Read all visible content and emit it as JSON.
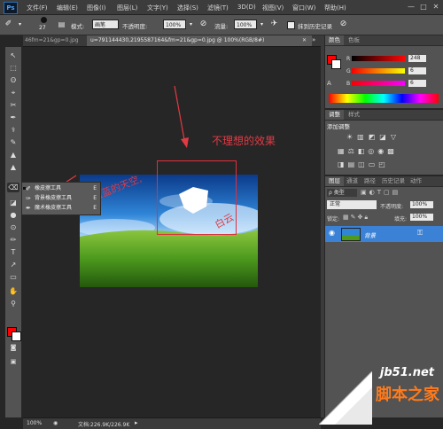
{
  "menubar": {
    "logo": "Ps",
    "items": [
      "文件(F)",
      "编辑(E)",
      "图像(I)",
      "图层(L)",
      "文字(Y)",
      "选择(S)",
      "滤镜(T)",
      "3D(D)",
      "视图(V)",
      "窗口(W)",
      "帮助(H)"
    ],
    "window_controls": [
      "—",
      "□",
      "✕"
    ]
  },
  "options": {
    "brush_size": "27",
    "mode_label": "模式:",
    "mode_value": "画笔",
    "opacity_label": "不透明度:",
    "opacity_value": "100%",
    "flow_label": "流量:",
    "flow_value": "100%",
    "history_label": "抹到历史记录"
  },
  "tabs": [
    {
      "label": "46fm=21&gp=0.jpg",
      "active": false
    },
    {
      "label": "u=791144430,2195587164&fm=21&gp=0.jpg @ 100%(RGB/8#)",
      "active": true
    }
  ],
  "tab_controls": [
    "✕",
    "»"
  ],
  "tools": [
    "↖",
    "⬚",
    "ʘ",
    "⌖",
    "✂",
    "✒",
    "⚕",
    "✎",
    "▲",
    "⌫",
    "◪",
    "●",
    "⊙",
    "✏",
    "T",
    "↗",
    "▭",
    "✋",
    "⚲"
  ],
  "tool_flyout": [
    {
      "icon": "✐",
      "label": "橡皮擦工具",
      "key": "E",
      "selected": true
    },
    {
      "icon": "✑",
      "label": "背景橡皮擦工具",
      "key": "E",
      "selected": false
    },
    {
      "icon": "✒",
      "label": "魔术橡皮擦工具",
      "key": "E",
      "selected": false
    }
  ],
  "colors": {
    "foreground": "#ff0000",
    "background": "#ffffff",
    "annotation": "#e23a44"
  },
  "annotation": {
    "text": "不理想的效果",
    "image_text_left": "蓝蓝的天空,",
    "image_text_right": "白云"
  },
  "status": {
    "zoom": "100%",
    "doc_size": "文档:226.9K/226.9K"
  },
  "color_panel": {
    "tabs": [
      "颜色",
      "色板"
    ],
    "channels": [
      {
        "label": "R",
        "value": "248"
      },
      {
        "label": "G",
        "value": "6"
      },
      {
        "label": "B",
        "value": "6"
      }
    ]
  },
  "adjust_panel": {
    "tabs": [
      "调整",
      "样式"
    ],
    "title": "添加调整"
  },
  "layers_panel": {
    "tabs": [
      "图层",
      "通道",
      "路径",
      "历史记录",
      "动作"
    ],
    "filter_label": "ρ 类型",
    "blend_mode": "正常",
    "opacity_label": "不透明度:",
    "opacity_value": "100%",
    "lock_label": "锁定:",
    "fill_label": "填充:",
    "fill_value": "100%",
    "layer_name": "背景"
  },
  "watermark": {
    "site": "jb51.net",
    "name": "脚本之家"
  }
}
